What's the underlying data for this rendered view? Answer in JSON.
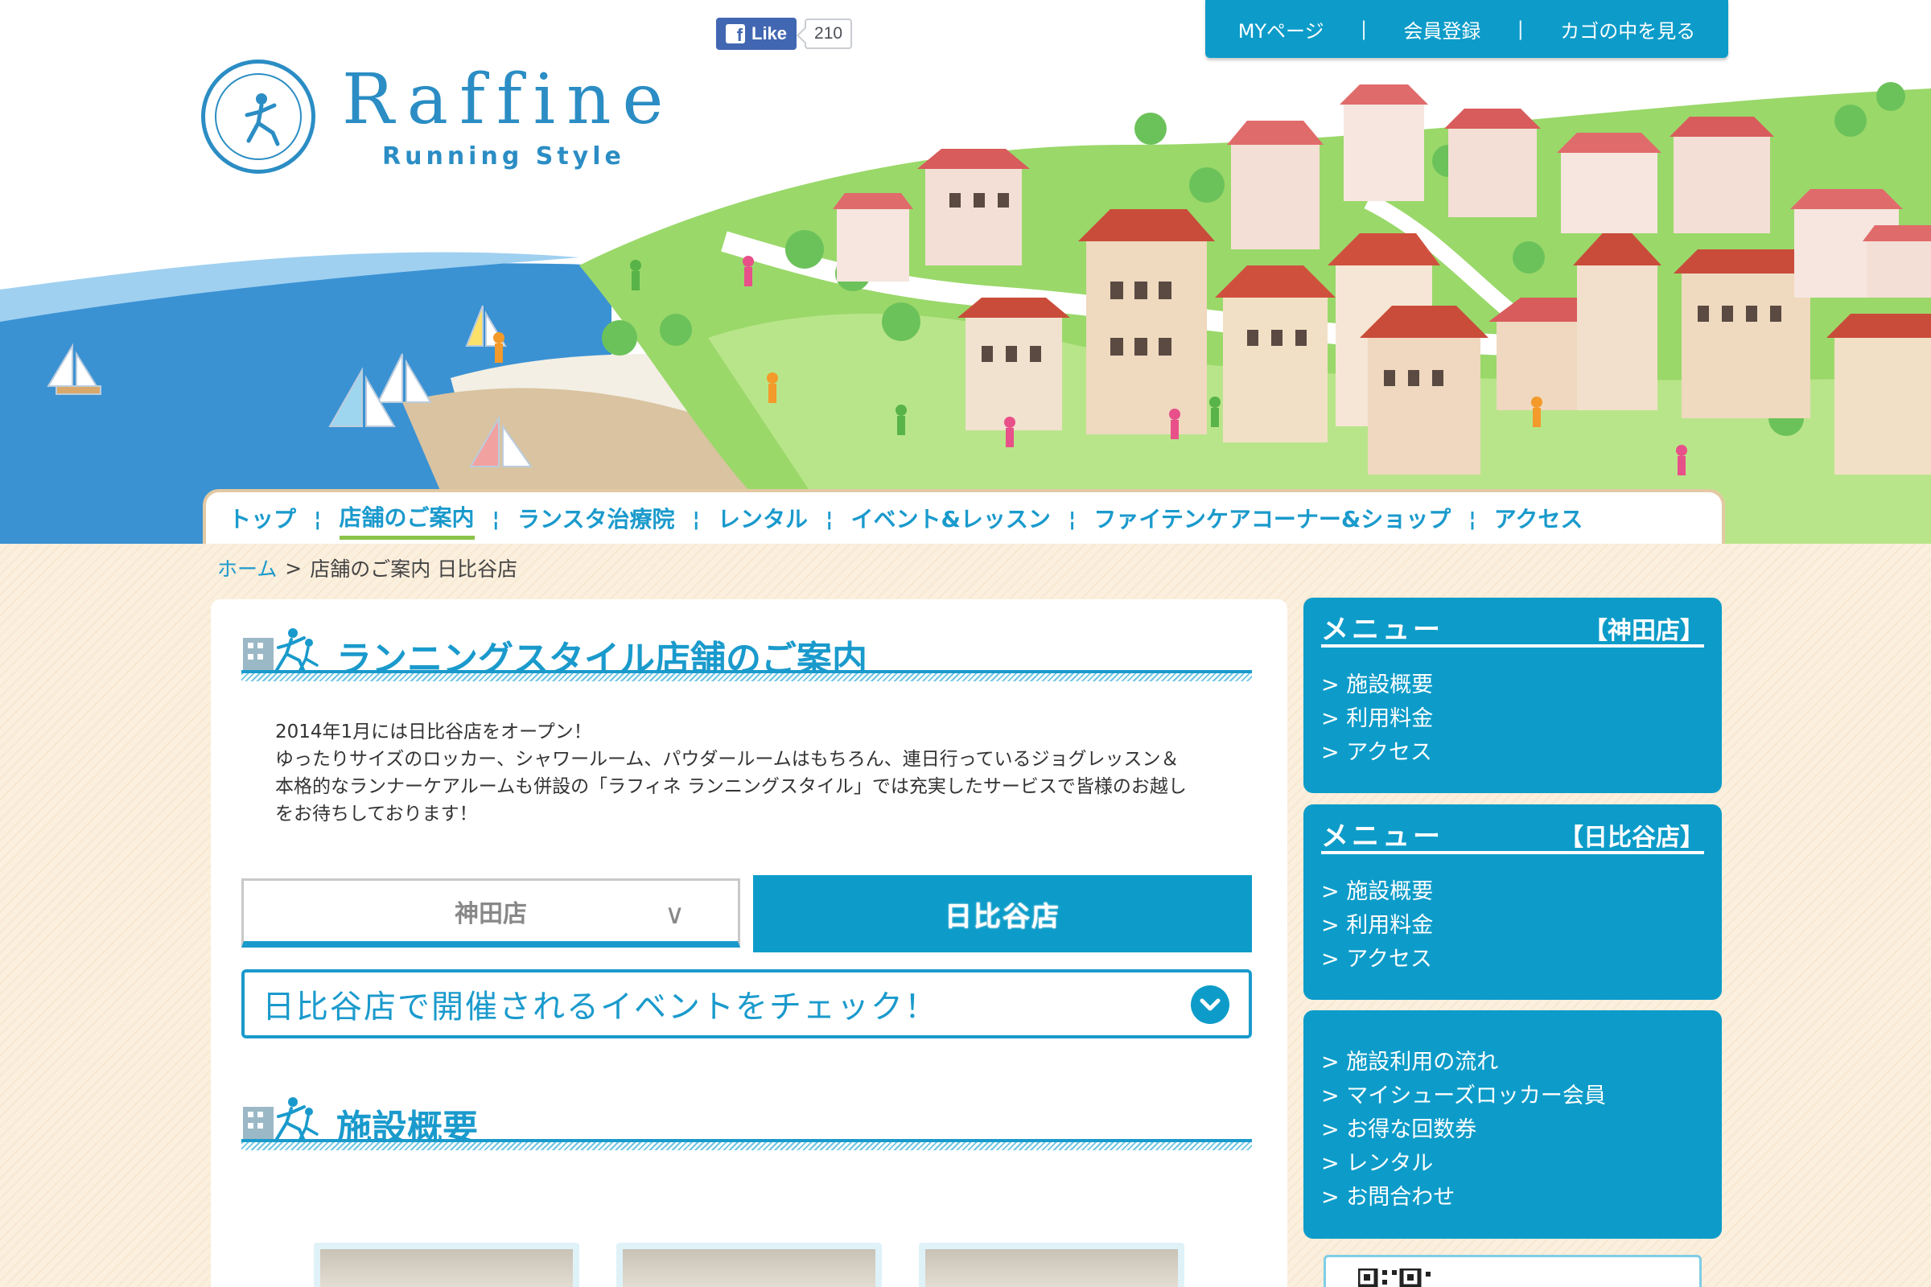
{
  "facebook": {
    "like_label": "Like",
    "like_count": "210"
  },
  "account_bar": {
    "items": [
      "MYページ",
      "会員登録",
      "カゴの中を見る"
    ],
    "separator": "|"
  },
  "logo": {
    "name": "Raffine",
    "sub": "Running Style",
    "ring_text": "Raffine Running Style"
  },
  "nav": {
    "items": [
      "トップ",
      "店舗のご案内",
      "ランスタ治療院",
      "レンタル",
      "イベント&レッスン",
      "ファイテンケアコーナー&ショップ",
      "アクセス"
    ],
    "active_index": 1,
    "separator": "¦"
  },
  "breadcrumb": {
    "home": "ホーム",
    "arrow": ">",
    "current": "店舗のご案内 日比谷店"
  },
  "main": {
    "title": "ランニングスタイル店舗のご案内",
    "intro": [
      "2014年1月には日比谷店をオープン！",
      "ゆったりサイズのロッカー、シャワールーム、パウダールームはもちろん、連日行っているジョグレッスン＆",
      "本格的なランナーケアルームも併設の「ラフィネ ランニングスタイル」では充実したサービスで皆様のお越し",
      "をお待ちしております！"
    ],
    "tabs": {
      "kanda": "神田店",
      "hibiya": "日比谷店"
    },
    "event_bar": "日比谷店で開催されるイベントをチェック！",
    "section2_title": "施設概要"
  },
  "sidebar": {
    "kanda": {
      "menu": "メニュー",
      "store": "【神田店】",
      "items": [
        "> 施設概要",
        "> 利用料金",
        "> アクセス"
      ]
    },
    "hibiya": {
      "menu": "メニュー",
      "store": "【日比谷店】",
      "items": [
        "> 施設概要",
        "> 利用料金",
        "> アクセス"
      ]
    },
    "general": {
      "items": [
        "> 施設利用の流れ",
        "> マイシューズロッカー会員",
        "> お得な回数券",
        "> レンタル",
        "> お問合わせ"
      ]
    }
  },
  "colors": {
    "brand_blue": "#0d9cc9",
    "nav_active_underline": "#8bc34a",
    "sea": "#3a8fd0",
    "grass": "#9ad86a"
  }
}
